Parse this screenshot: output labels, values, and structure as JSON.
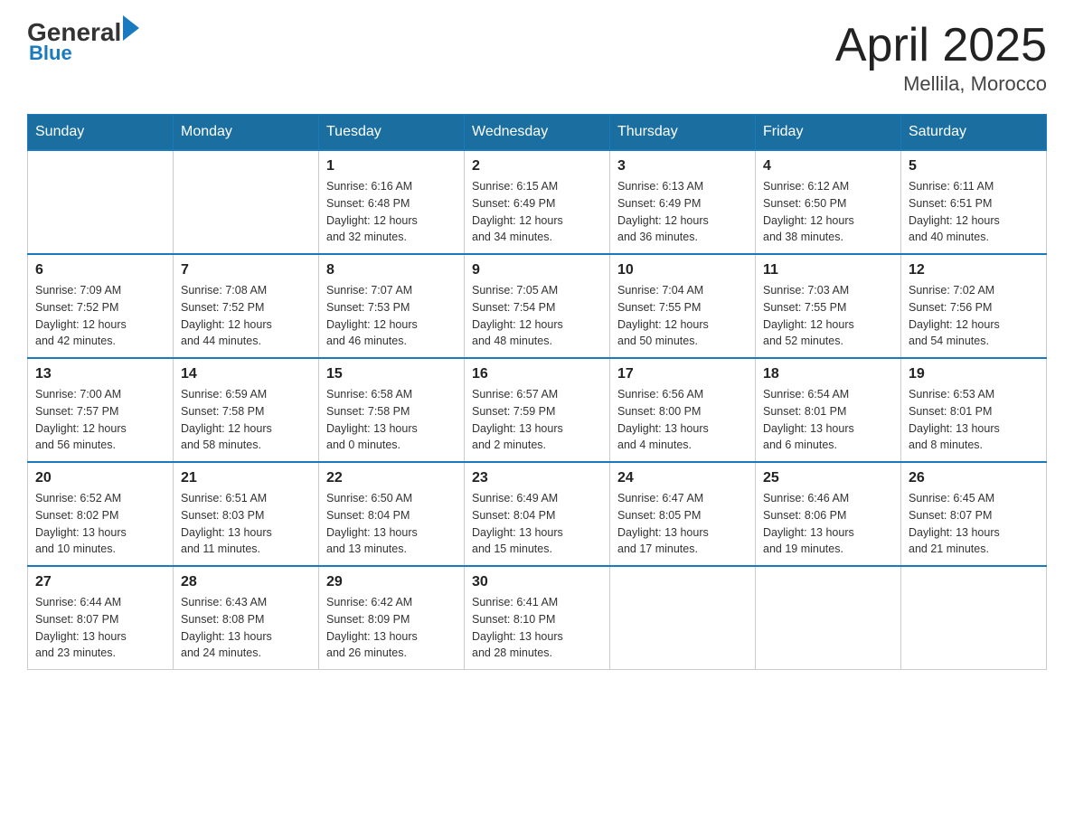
{
  "header": {
    "logo_general": "General",
    "logo_blue": "Blue",
    "logo_underline": "Blue",
    "month": "April 2025",
    "location": "Mellila, Morocco"
  },
  "days_of_week": [
    "Sunday",
    "Monday",
    "Tuesday",
    "Wednesday",
    "Thursday",
    "Friday",
    "Saturday"
  ],
  "weeks": [
    [
      {
        "day": "",
        "info": ""
      },
      {
        "day": "",
        "info": ""
      },
      {
        "day": "1",
        "info": "Sunrise: 6:16 AM\nSunset: 6:48 PM\nDaylight: 12 hours\nand 32 minutes."
      },
      {
        "day": "2",
        "info": "Sunrise: 6:15 AM\nSunset: 6:49 PM\nDaylight: 12 hours\nand 34 minutes."
      },
      {
        "day": "3",
        "info": "Sunrise: 6:13 AM\nSunset: 6:49 PM\nDaylight: 12 hours\nand 36 minutes."
      },
      {
        "day": "4",
        "info": "Sunrise: 6:12 AM\nSunset: 6:50 PM\nDaylight: 12 hours\nand 38 minutes."
      },
      {
        "day": "5",
        "info": "Sunrise: 6:11 AM\nSunset: 6:51 PM\nDaylight: 12 hours\nand 40 minutes."
      }
    ],
    [
      {
        "day": "6",
        "info": "Sunrise: 7:09 AM\nSunset: 7:52 PM\nDaylight: 12 hours\nand 42 minutes."
      },
      {
        "day": "7",
        "info": "Sunrise: 7:08 AM\nSunset: 7:52 PM\nDaylight: 12 hours\nand 44 minutes."
      },
      {
        "day": "8",
        "info": "Sunrise: 7:07 AM\nSunset: 7:53 PM\nDaylight: 12 hours\nand 46 minutes."
      },
      {
        "day": "9",
        "info": "Sunrise: 7:05 AM\nSunset: 7:54 PM\nDaylight: 12 hours\nand 48 minutes."
      },
      {
        "day": "10",
        "info": "Sunrise: 7:04 AM\nSunset: 7:55 PM\nDaylight: 12 hours\nand 50 minutes."
      },
      {
        "day": "11",
        "info": "Sunrise: 7:03 AM\nSunset: 7:55 PM\nDaylight: 12 hours\nand 52 minutes."
      },
      {
        "day": "12",
        "info": "Sunrise: 7:02 AM\nSunset: 7:56 PM\nDaylight: 12 hours\nand 54 minutes."
      }
    ],
    [
      {
        "day": "13",
        "info": "Sunrise: 7:00 AM\nSunset: 7:57 PM\nDaylight: 12 hours\nand 56 minutes."
      },
      {
        "day": "14",
        "info": "Sunrise: 6:59 AM\nSunset: 7:58 PM\nDaylight: 12 hours\nand 58 minutes."
      },
      {
        "day": "15",
        "info": "Sunrise: 6:58 AM\nSunset: 7:58 PM\nDaylight: 13 hours\nand 0 minutes."
      },
      {
        "day": "16",
        "info": "Sunrise: 6:57 AM\nSunset: 7:59 PM\nDaylight: 13 hours\nand 2 minutes."
      },
      {
        "day": "17",
        "info": "Sunrise: 6:56 AM\nSunset: 8:00 PM\nDaylight: 13 hours\nand 4 minutes."
      },
      {
        "day": "18",
        "info": "Sunrise: 6:54 AM\nSunset: 8:01 PM\nDaylight: 13 hours\nand 6 minutes."
      },
      {
        "day": "19",
        "info": "Sunrise: 6:53 AM\nSunset: 8:01 PM\nDaylight: 13 hours\nand 8 minutes."
      }
    ],
    [
      {
        "day": "20",
        "info": "Sunrise: 6:52 AM\nSunset: 8:02 PM\nDaylight: 13 hours\nand 10 minutes."
      },
      {
        "day": "21",
        "info": "Sunrise: 6:51 AM\nSunset: 8:03 PM\nDaylight: 13 hours\nand 11 minutes."
      },
      {
        "day": "22",
        "info": "Sunrise: 6:50 AM\nSunset: 8:04 PM\nDaylight: 13 hours\nand 13 minutes."
      },
      {
        "day": "23",
        "info": "Sunrise: 6:49 AM\nSunset: 8:04 PM\nDaylight: 13 hours\nand 15 minutes."
      },
      {
        "day": "24",
        "info": "Sunrise: 6:47 AM\nSunset: 8:05 PM\nDaylight: 13 hours\nand 17 minutes."
      },
      {
        "day": "25",
        "info": "Sunrise: 6:46 AM\nSunset: 8:06 PM\nDaylight: 13 hours\nand 19 minutes."
      },
      {
        "day": "26",
        "info": "Sunrise: 6:45 AM\nSunset: 8:07 PM\nDaylight: 13 hours\nand 21 minutes."
      }
    ],
    [
      {
        "day": "27",
        "info": "Sunrise: 6:44 AM\nSunset: 8:07 PM\nDaylight: 13 hours\nand 23 minutes."
      },
      {
        "day": "28",
        "info": "Sunrise: 6:43 AM\nSunset: 8:08 PM\nDaylight: 13 hours\nand 24 minutes."
      },
      {
        "day": "29",
        "info": "Sunrise: 6:42 AM\nSunset: 8:09 PM\nDaylight: 13 hours\nand 26 minutes."
      },
      {
        "day": "30",
        "info": "Sunrise: 6:41 AM\nSunset: 8:10 PM\nDaylight: 13 hours\nand 28 minutes."
      },
      {
        "day": "",
        "info": ""
      },
      {
        "day": "",
        "info": ""
      },
      {
        "day": "",
        "info": ""
      }
    ]
  ]
}
